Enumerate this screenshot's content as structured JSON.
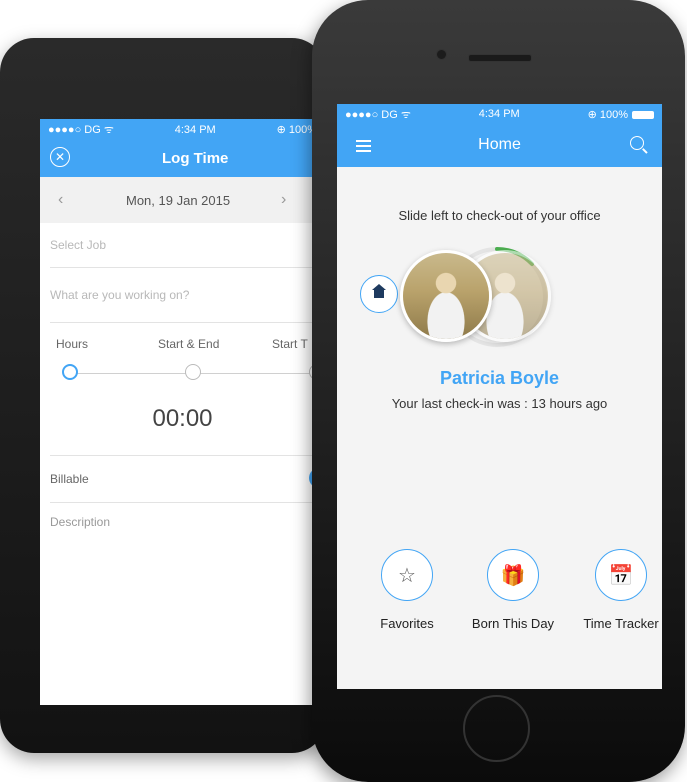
{
  "android": {
    "status": {
      "carrier": "●●●●○ DG ᯤ",
      "time": "4:34 PM",
      "battery": "⊕ 100%"
    },
    "header": {
      "title": "Log Time"
    },
    "date_nav": {
      "prev": "‹",
      "date": "Mon, 19 Jan 2015",
      "next": "›"
    },
    "fields": {
      "job_placeholder": "Select Job",
      "work_placeholder": "What are you working on?"
    },
    "modes": [
      "Hours",
      "Start & End",
      "Start T"
    ],
    "duration": "00:00",
    "billable_label": "Billable",
    "description_label": "Description"
  },
  "iphone": {
    "status": {
      "carrier": "●●●●○ DG ᯤ",
      "time": "4:34 PM",
      "battery": "⊕ 100%"
    },
    "header": {
      "title": "Home"
    },
    "hint": "Slide left to check-out of your office",
    "user": {
      "name": "Patricia Boyle",
      "last_checkin": "Your last check-in was : 13 hours ago"
    },
    "actions": [
      {
        "label": "Favorites",
        "icon": "☆"
      },
      {
        "label": "Born This Day",
        "icon": "🎁"
      },
      {
        "label": "Time Tracker",
        "icon": "📅"
      }
    ]
  },
  "colors": {
    "accent": "#42a5f5",
    "dark_icon": "#1e3a5f",
    "ring": "#4caf50"
  }
}
